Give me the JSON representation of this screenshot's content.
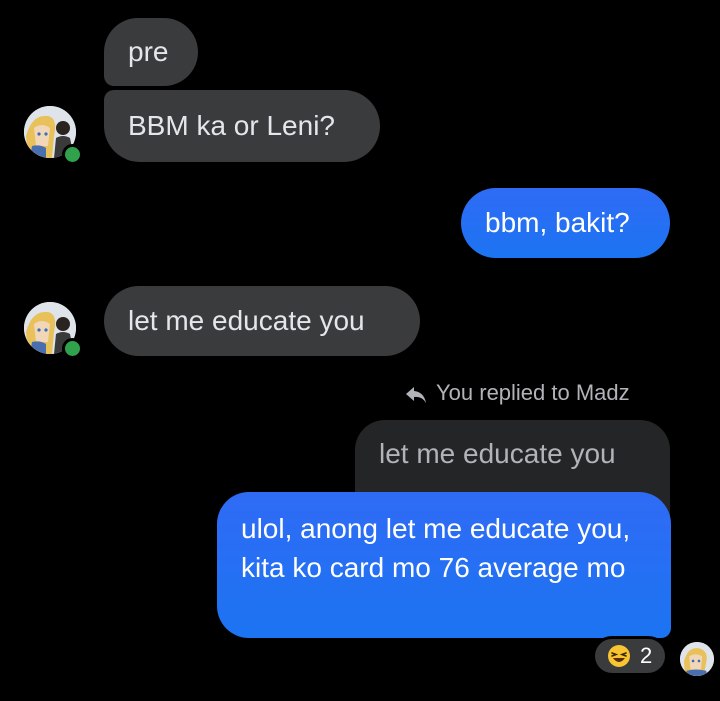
{
  "conversation": {
    "messages": [
      {
        "sender": "other",
        "text": "pre"
      },
      {
        "sender": "other",
        "text": "BBM ka or Leni?"
      },
      {
        "sender": "me",
        "text": "bbm, bakit?"
      },
      {
        "sender": "other",
        "text": "let me educate you"
      },
      {
        "sender": "me",
        "text": "ulol, anong let me educate you, kita ko card mo 76 average mo"
      }
    ],
    "reply": {
      "label": "You replied to Madz",
      "quoted_text": "let me educate you",
      "icon": "reply-arrow-icon"
    },
    "reaction": {
      "emoji": "laughing-emoji",
      "count": "2"
    }
  },
  "colors": {
    "background": "#000000",
    "incoming_bubble": "#3a3b3c",
    "outgoing_bubble": "#1c74f2",
    "quoted_bubble": "#242526",
    "online_indicator": "#31a24c",
    "muted_text": "#b0b3b8"
  }
}
